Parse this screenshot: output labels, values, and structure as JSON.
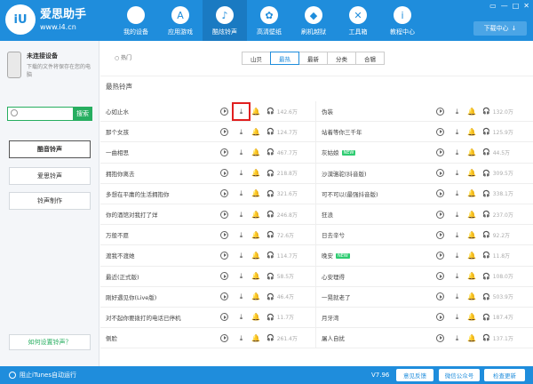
{
  "brand": {
    "name": "爱思助手",
    "url": "www.i4.cn",
    "logo_text": "iU"
  },
  "nav": [
    {
      "label": "我的设备",
      "icon": "apple-icon",
      "glyph": ""
    },
    {
      "label": "应用游戏",
      "icon": "app-store-icon",
      "glyph": "A"
    },
    {
      "label": "酷炫铃声",
      "icon": "bell-icon",
      "glyph": "♪"
    },
    {
      "label": "高清壁纸",
      "icon": "flower-icon",
      "glyph": "✿"
    },
    {
      "label": "刷机越狱",
      "icon": "dropbox-icon",
      "glyph": "◆"
    },
    {
      "label": "工具箱",
      "icon": "tools-icon",
      "glyph": "✕"
    },
    {
      "label": "教程中心",
      "icon": "info-icon",
      "glyph": "i"
    }
  ],
  "download_center": {
    "label": "下载中心",
    "arrow": "↓"
  },
  "window_controls": [
    "▭",
    "—",
    "□",
    "✕"
  ],
  "device": {
    "title": "未连接设备",
    "desc": "下载的文件将保存在您的电脑"
  },
  "search": {
    "button": "搜索",
    "placeholder": ""
  },
  "sidebar_buttons": [
    "酷音铃声",
    "爱思铃声",
    "铃声制作"
  ],
  "help_link": "如何设置铃声？",
  "filter": {
    "checkbox_label": "热门",
    "tabs": [
      "山贝",
      "最热",
      "最新",
      "分类",
      "合辑"
    ],
    "active_tab": "最热"
  },
  "section_title": "最热铃声",
  "icons": {
    "download": "⤓",
    "bell": "🔔",
    "plays": "🎧"
  },
  "new_badge": "NEW",
  "songs_left": [
    {
      "name": "心如止水",
      "plays": "142.6万",
      "new": false
    },
    {
      "name": "那个女孩",
      "plays": "124.7万",
      "new": false
    },
    {
      "name": "一曲相思",
      "plays": "467.7万",
      "new": false
    },
    {
      "name": "拥抱你离去",
      "plays": "218.8万",
      "new": false
    },
    {
      "name": "多想在平庸的生活拥抱你",
      "plays": "321.6万",
      "new": false
    },
    {
      "name": "你的酒馆对我打了烊",
      "plays": "246.8万",
      "new": false
    },
    {
      "name": "万般不愿",
      "plays": "72.6万",
      "new": false
    },
    {
      "name": "渡我不渡她",
      "plays": "114.7万",
      "new": false
    },
    {
      "name": "最近(正式版)",
      "plays": "58.5万",
      "new": false
    },
    {
      "name": "刚好遇见你(Live版)",
      "plays": "46.4万",
      "new": false
    },
    {
      "name": "对不起你要拨打的电话已停机",
      "plays": "11.7万",
      "new": false
    },
    {
      "name": "侧脸",
      "plays": "261.4万",
      "new": false
    }
  ],
  "songs_right": [
    {
      "name": "伪装",
      "plays": "132.0万",
      "new": false
    },
    {
      "name": "站着等你三千年",
      "plays": "125.9万",
      "new": false
    },
    {
      "name": "灰姑娘",
      "plays": "44.5万",
      "new": true
    },
    {
      "name": "沙漠骆驼(抖音版)",
      "plays": "309.5万",
      "new": false
    },
    {
      "name": "可不可以(最强抖音版)",
      "plays": "338.1万",
      "new": false
    },
    {
      "name": "狂浪",
      "plays": "237.0万",
      "new": false
    },
    {
      "name": "日去辛兮",
      "plays": "92.2万",
      "new": false
    },
    {
      "name": "晚安",
      "plays": "11.8万",
      "new": true
    },
    {
      "name": "心安理得",
      "plays": "108.0万",
      "new": false
    },
    {
      "name": "一晃就老了",
      "plays": "503.9万",
      "new": false
    },
    {
      "name": "月牙湾",
      "plays": "187.4万",
      "new": false
    },
    {
      "name": "屠人自扰",
      "plays": "137.1万",
      "new": false
    }
  ],
  "status": {
    "itunes": "阻止iTunes自动运行",
    "version": "V7.96",
    "feedback": "意见反馈",
    "wechat": "微信公众号",
    "update": "检查更新"
  }
}
